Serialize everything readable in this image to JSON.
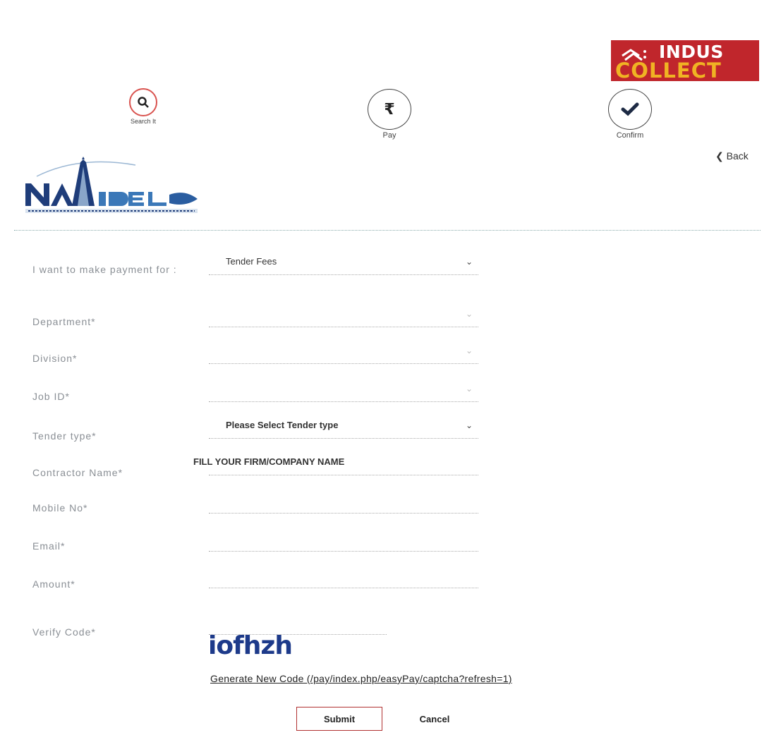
{
  "brand": {
    "line1": "INDUS",
    "line2": "COLLECT",
    "colors": {
      "background": "#c0262c",
      "accent": "#f0b323"
    }
  },
  "steps": [
    {
      "label": "Search It",
      "icon": "search-icon",
      "color": "#d9534f"
    },
    {
      "label": "Pay",
      "icon": "rupee-icon"
    },
    {
      "label": "Confirm",
      "icon": "check-icon"
    }
  ],
  "nav": {
    "back_label": "❮ Back"
  },
  "form": {
    "payment_for": {
      "label": "I want to make payment for :",
      "value": "Tender Fees"
    },
    "department": {
      "label": "Department*",
      "value": ""
    },
    "division": {
      "label": "Division*",
      "value": ""
    },
    "job_id": {
      "label": "Job ID*",
      "value": ""
    },
    "tender_type": {
      "label": "Tender type*",
      "value": "Please Select Tender type"
    },
    "contractor_name": {
      "label": "Contractor Name*",
      "value": "FILL YOUR FIRM/COMPANY NAME"
    },
    "mobile": {
      "label": "Mobile No*",
      "value": ""
    },
    "email": {
      "label": "Email*",
      "value": ""
    },
    "amount": {
      "label": "Amount*",
      "value": ""
    },
    "verify_code": {
      "label": "Verify Code*",
      "value": ""
    },
    "captcha_text": "iofhzh",
    "new_code_link": "Generate New Code (/pay/index.php/easyPay/captcha?refresh=1)"
  },
  "buttons": {
    "submit": "Submit",
    "cancel": "Cancel"
  }
}
